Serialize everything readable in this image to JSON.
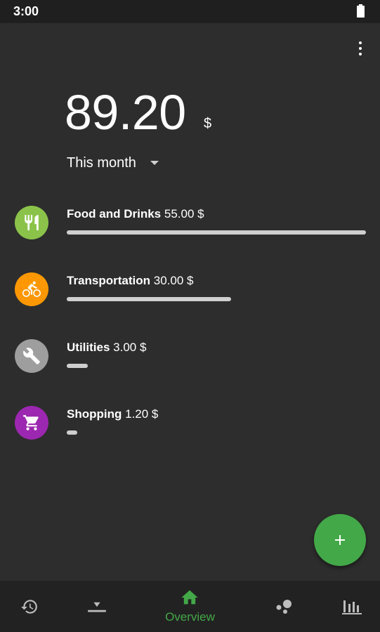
{
  "status_bar": {
    "time": "3:00"
  },
  "total": {
    "amount": "89.20",
    "currency": "$"
  },
  "period": {
    "label": "This month"
  },
  "categories": [
    {
      "name": "Food and Drinks",
      "amount": "55.00 $",
      "color": "#8bc34a",
      "icon": "restaurant-icon",
      "share": 1.0
    },
    {
      "name": "Transportation",
      "amount": "30.00 $",
      "color": "#ff9800",
      "icon": "bicycle-icon",
      "share": 0.55
    },
    {
      "name": "Utilities",
      "amount": "3.00 $",
      "color": "#9e9e9e",
      "icon": "wrench-icon",
      "share": 0.07
    },
    {
      "name": "Shopping",
      "amount": "1.20 $",
      "color": "#9c27b0",
      "icon": "shopping-cart-icon",
      "share": 0.035
    }
  ],
  "fab": {
    "icon": "plus-icon",
    "color": "#43a848"
  },
  "bottom_nav": {
    "items": [
      {
        "icon": "history-icon",
        "label": ""
      },
      {
        "icon": "import-icon",
        "label": ""
      },
      {
        "icon": "home-icon",
        "label": "Overview"
      },
      {
        "icon": "bubbles-icon",
        "label": ""
      },
      {
        "icon": "bar-chart-icon",
        "label": ""
      }
    ],
    "active_color": "#43a848"
  }
}
